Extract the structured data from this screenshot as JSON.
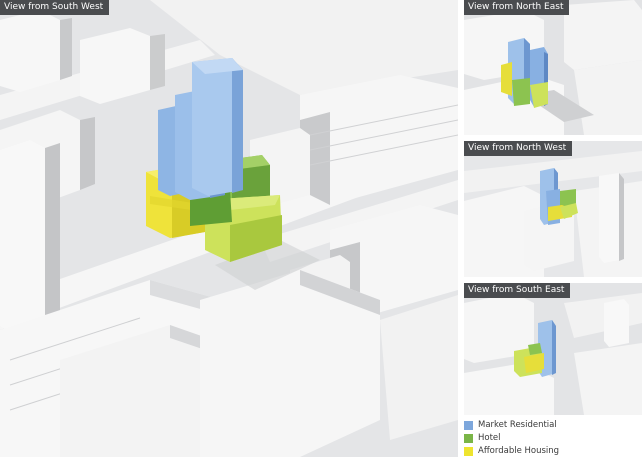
{
  "views": {
    "main": {
      "label": "View from South West"
    },
    "north_east": {
      "label": "View from North East"
    },
    "north_west": {
      "label": "View from North West"
    },
    "south_east": {
      "label": "View from South East"
    }
  },
  "legend": {
    "items": [
      {
        "label": "Market Residential",
        "color": "#7da7dc"
      },
      {
        "label": "Hotel",
        "color": "#7ab547"
      },
      {
        "label": "Affordable Housing",
        "color": "#eee42f"
      }
    ]
  }
}
